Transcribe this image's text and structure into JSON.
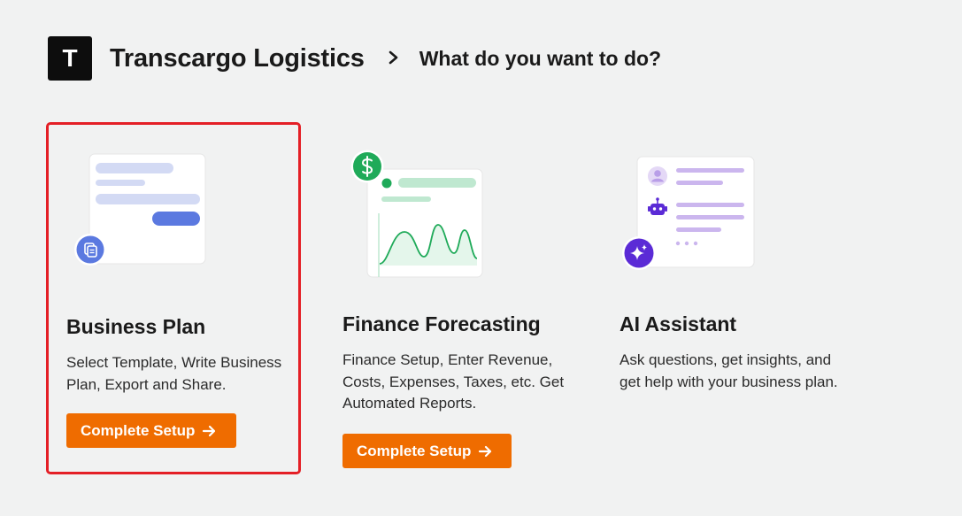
{
  "header": {
    "logo_letter": "T",
    "company_name": "Transcargo Logistics",
    "separator_icon": "chevron-right-icon",
    "page_title": "What do you want to do?"
  },
  "cards": [
    {
      "title": "Business Plan",
      "description": "Select Template, Write Business Plan, Export and Share.",
      "button_label": "Complete Setup",
      "button_icon": "arrow-right-icon",
      "illustration_icon": "document-icon",
      "selected": true
    },
    {
      "title": "Finance Forecasting",
      "description": "Finance Setup, Enter Revenue, Costs, Expenses, Taxes, etc. Get Automated Reports.",
      "button_label": "Complete Setup",
      "button_icon": "arrow-right-icon",
      "illustration_icon": "dollar-icon",
      "selected": false
    },
    {
      "title": "AI Assistant",
      "description": "Ask questions, get insights, and get help with your business plan.",
      "illustration_icon": "sparkle-icon",
      "selected": false
    }
  ],
  "colors": {
    "background": "#f1f2f2",
    "accent_orange": "#ef6c00",
    "selection_red": "#e41f26",
    "business_blue": "#5b79e0",
    "finance_green": "#1faa59",
    "ai_purple": "#5b2bd6"
  }
}
